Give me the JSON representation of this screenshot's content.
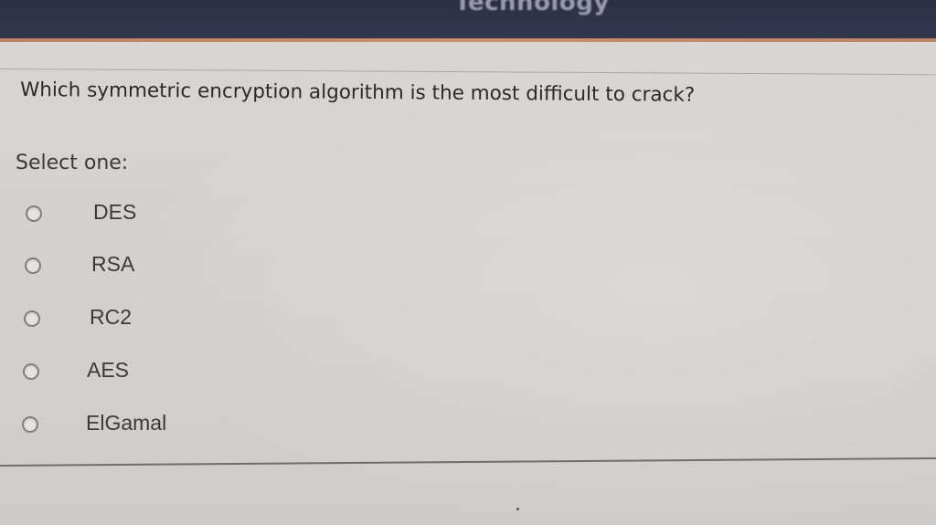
{
  "header": {
    "title": "Technology"
  },
  "question": {
    "text": "Which symmetric encryption algorithm is the most difficult to crack?",
    "select_label": "Select one:",
    "options": [
      {
        "label": "DES"
      },
      {
        "label": "RSA"
      },
      {
        "label": "RC2"
      },
      {
        "label": "AES"
      },
      {
        "label": "ElGamal"
      }
    ]
  }
}
